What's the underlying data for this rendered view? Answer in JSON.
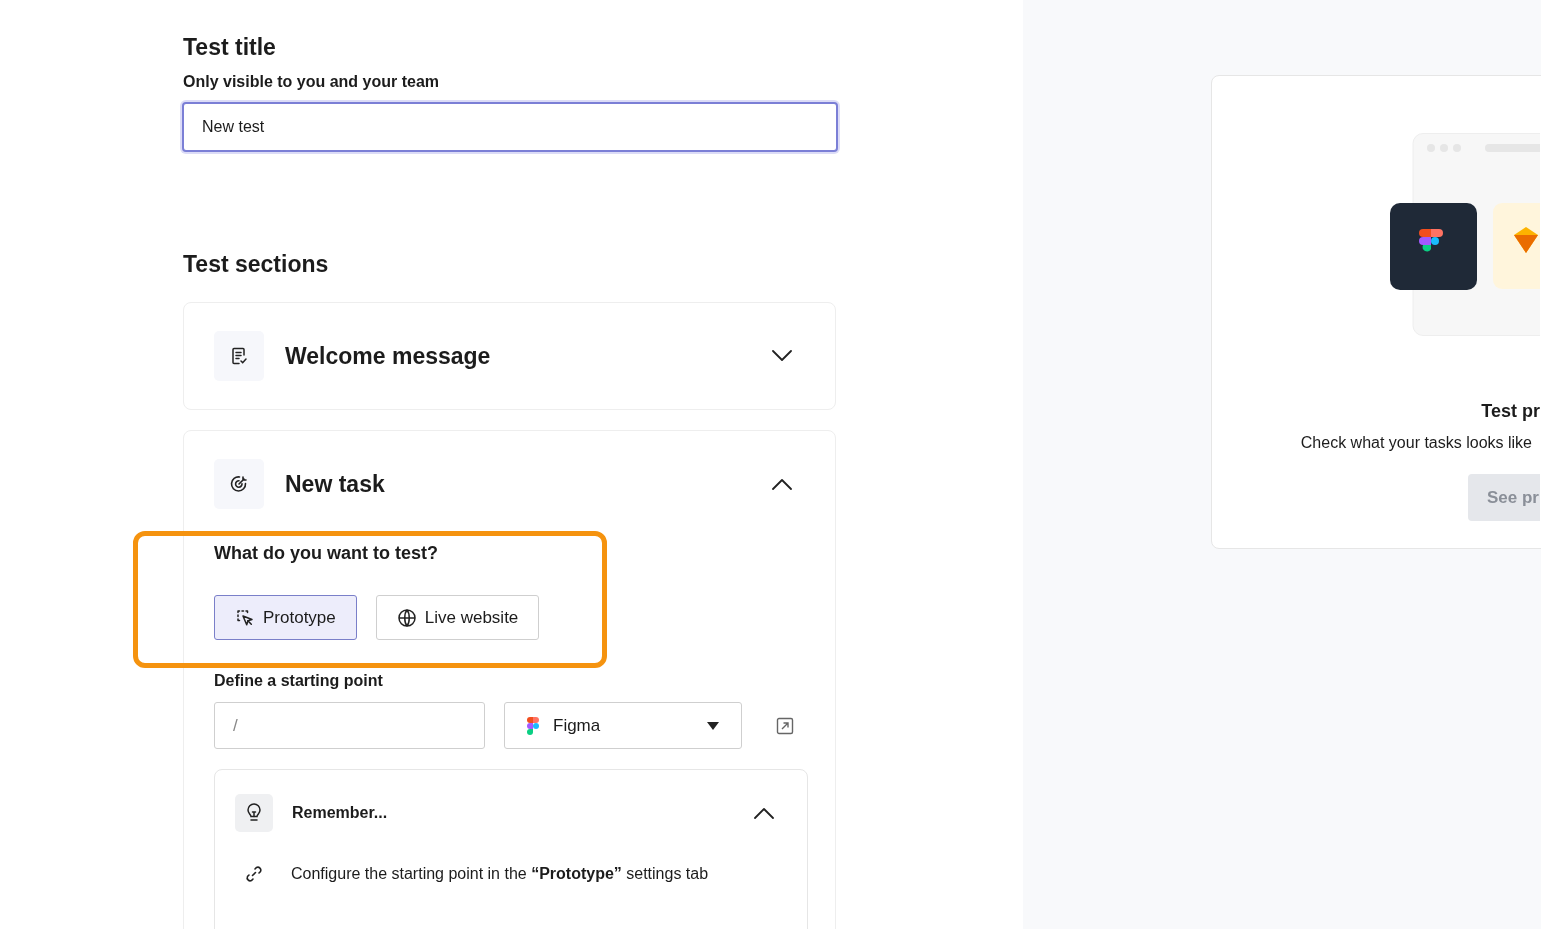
{
  "title_field": {
    "heading": "Test title",
    "hint": "Only visible to you and your team",
    "value": "New test"
  },
  "sections_heading": "Test sections",
  "sections": [
    {
      "kind": "message",
      "title": "Welcome message",
      "expanded": false
    },
    {
      "kind": "task",
      "title": "New task",
      "expanded": true
    }
  ],
  "task": {
    "question": "What do you want to test?",
    "highlighted": true,
    "options": [
      {
        "kind": "prototype",
        "label": "Prototype",
        "selected": true
      },
      {
        "kind": "website",
        "label": "Live website",
        "selected": false
      }
    ],
    "starting_point": {
      "label": "Define a starting point",
      "placeholder": "/",
      "tool": "Figma"
    },
    "remember": {
      "title": "Remember...",
      "expanded": true,
      "text": "Configure the starting point in the **“Prototype”** settings tab"
    }
  },
  "preview": {
    "title": "Test pr",
    "text": "Check what your tasks looks like",
    "button": "See pr"
  }
}
